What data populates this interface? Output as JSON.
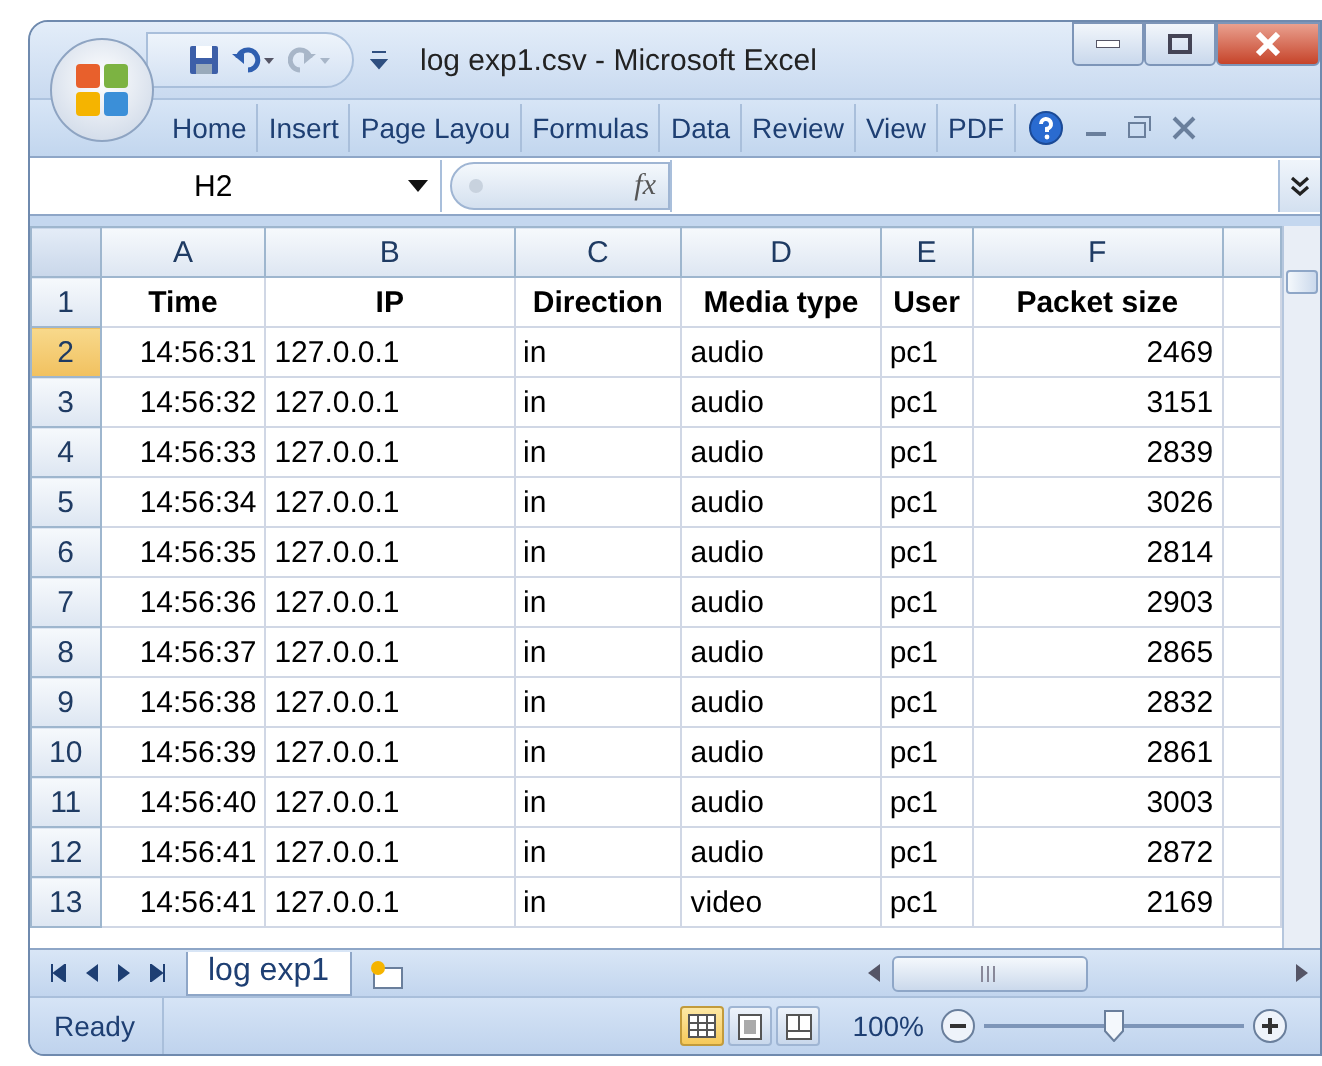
{
  "window": {
    "title": "log exp1.csv - Microsoft Excel"
  },
  "ribbon_tabs": [
    "Home",
    "Insert",
    "Page Layou",
    "Formulas",
    "Data",
    "Review",
    "View",
    "PDF"
  ],
  "formula_bar": {
    "name_box": "H2",
    "function_label": "fx"
  },
  "sheet": {
    "columns": [
      {
        "label": "A"
      },
      {
        "label": "B"
      },
      {
        "label": "C"
      },
      {
        "label": "D"
      },
      {
        "label": "E"
      },
      {
        "label": "F"
      }
    ],
    "rows": [
      {
        "number": "1",
        "kind": "header",
        "selected": false,
        "cells": [
          "Time",
          "IP",
          "Direction",
          "Media type",
          "User",
          "Packet size"
        ]
      },
      {
        "number": "2",
        "kind": "data",
        "selected": true,
        "cells": [
          "14:56:31",
          "127.0.0.1",
          "in",
          "audio",
          "pc1",
          "2469"
        ]
      },
      {
        "number": "3",
        "kind": "data",
        "selected": false,
        "cells": [
          "14:56:32",
          "127.0.0.1",
          "in",
          "audio",
          "pc1",
          "3151"
        ]
      },
      {
        "number": "4",
        "kind": "data",
        "selected": false,
        "cells": [
          "14:56:33",
          "127.0.0.1",
          "in",
          "audio",
          "pc1",
          "2839"
        ]
      },
      {
        "number": "5",
        "kind": "data",
        "selected": false,
        "cells": [
          "14:56:34",
          "127.0.0.1",
          "in",
          "audio",
          "pc1",
          "3026"
        ]
      },
      {
        "number": "6",
        "kind": "data",
        "selected": false,
        "cells": [
          "14:56:35",
          "127.0.0.1",
          "in",
          "audio",
          "pc1",
          "2814"
        ]
      },
      {
        "number": "7",
        "kind": "data",
        "selected": false,
        "cells": [
          "14:56:36",
          "127.0.0.1",
          "in",
          "audio",
          "pc1",
          "2903"
        ]
      },
      {
        "number": "8",
        "kind": "data",
        "selected": false,
        "cells": [
          "14:56:37",
          "127.0.0.1",
          "in",
          "audio",
          "pc1",
          "2865"
        ]
      },
      {
        "number": "9",
        "kind": "data",
        "selected": false,
        "cells": [
          "14:56:38",
          "127.0.0.1",
          "in",
          "audio",
          "pc1",
          "2832"
        ]
      },
      {
        "number": "10",
        "kind": "data",
        "selected": false,
        "cells": [
          "14:56:39",
          "127.0.0.1",
          "in",
          "audio",
          "pc1",
          "2861"
        ]
      },
      {
        "number": "11",
        "kind": "data",
        "selected": false,
        "cells": [
          "14:56:40",
          "127.0.0.1",
          "in",
          "audio",
          "pc1",
          "3003"
        ]
      },
      {
        "number": "12",
        "kind": "data",
        "selected": false,
        "cells": [
          "14:56:41",
          "127.0.0.1",
          "in",
          "audio",
          "pc1",
          "2872"
        ]
      },
      {
        "number": "13",
        "kind": "data",
        "selected": false,
        "cells": [
          "14:56:41",
          "127.0.0.1",
          "in",
          "video",
          "pc1",
          "2169"
        ]
      }
    ]
  },
  "sheet_tabs": [
    {
      "label": "log exp1",
      "selected": true
    }
  ],
  "status_bar": {
    "text": "Ready",
    "views": [
      {
        "kind": "normal",
        "selected": true
      },
      {
        "kind": "page_layout",
        "selected": false
      },
      {
        "kind": "page_break",
        "selected": false
      }
    ],
    "zoom": "100%",
    "zoom_slider": {
      "level": 0.5
    }
  }
}
